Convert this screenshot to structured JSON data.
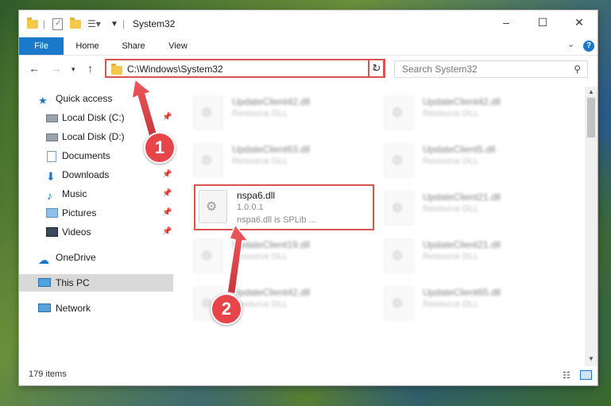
{
  "window": {
    "title": "System32",
    "controls": {
      "minimize": "–",
      "maximize": "☐",
      "close": "✕"
    }
  },
  "ribbon": {
    "tabs": [
      "File",
      "Home",
      "Share",
      "View"
    ],
    "help": "?"
  },
  "nav": {
    "address": "C:\\Windows\\System32",
    "search_placeholder": "Search System32"
  },
  "sidebar": {
    "items": [
      {
        "label": "Quick access",
        "icon": "star-icon",
        "pinned": false
      },
      {
        "label": "Local Disk (C:)",
        "icon": "drive-icon",
        "pinned": true
      },
      {
        "label": "Local Disk (D:)",
        "icon": "drive-icon",
        "pinned": false
      },
      {
        "label": "Documents",
        "icon": "documents-icon",
        "pinned": true
      },
      {
        "label": "Downloads",
        "icon": "downloads-icon",
        "pinned": true
      },
      {
        "label": "Music",
        "icon": "music-icon",
        "pinned": true
      },
      {
        "label": "Pictures",
        "icon": "pictures-icon",
        "pinned": true
      },
      {
        "label": "Videos",
        "icon": "videos-icon",
        "pinned": true
      },
      {
        "label": "OneDrive",
        "icon": "onedrive-icon",
        "pinned": false
      },
      {
        "label": "This PC",
        "icon": "pc-icon",
        "pinned": false
      },
      {
        "label": "Network",
        "icon": "network-icon",
        "pinned": false
      }
    ]
  },
  "files": {
    "left": [
      {
        "name": "UpdateClient42.dll",
        "type": "Resource DLL"
      },
      {
        "name": "UpdateClient63.dll",
        "type": "Resource DLL"
      },
      {
        "name": "nspa6.dll",
        "type": "1.0.0.1",
        "desc": "nspa6.dll is SPLib ..."
      },
      {
        "name": "UpdateClient19.dll",
        "type": "Resource DLL"
      },
      {
        "name": "UpdateClient42.dll",
        "type": "Resource DLL"
      }
    ],
    "right": [
      {
        "name": "UpdateClient42.dll",
        "type": "Resource DLL"
      },
      {
        "name": "UpdateClient5.dll",
        "type": "Resource DLL"
      },
      {
        "name": "UpdateClient21.dll",
        "type": "Resource DLL"
      },
      {
        "name": "UpdateClient21.dll",
        "type": "Resource DLL"
      },
      {
        "name": "UpdateClient65.dll",
        "type": "Resource DLL"
      }
    ]
  },
  "status": {
    "items": "179 items"
  },
  "callouts": [
    "1",
    "2"
  ],
  "colors": {
    "accent": "#1979ca",
    "highlight": "#d9534f",
    "callout": "#e8454b"
  }
}
